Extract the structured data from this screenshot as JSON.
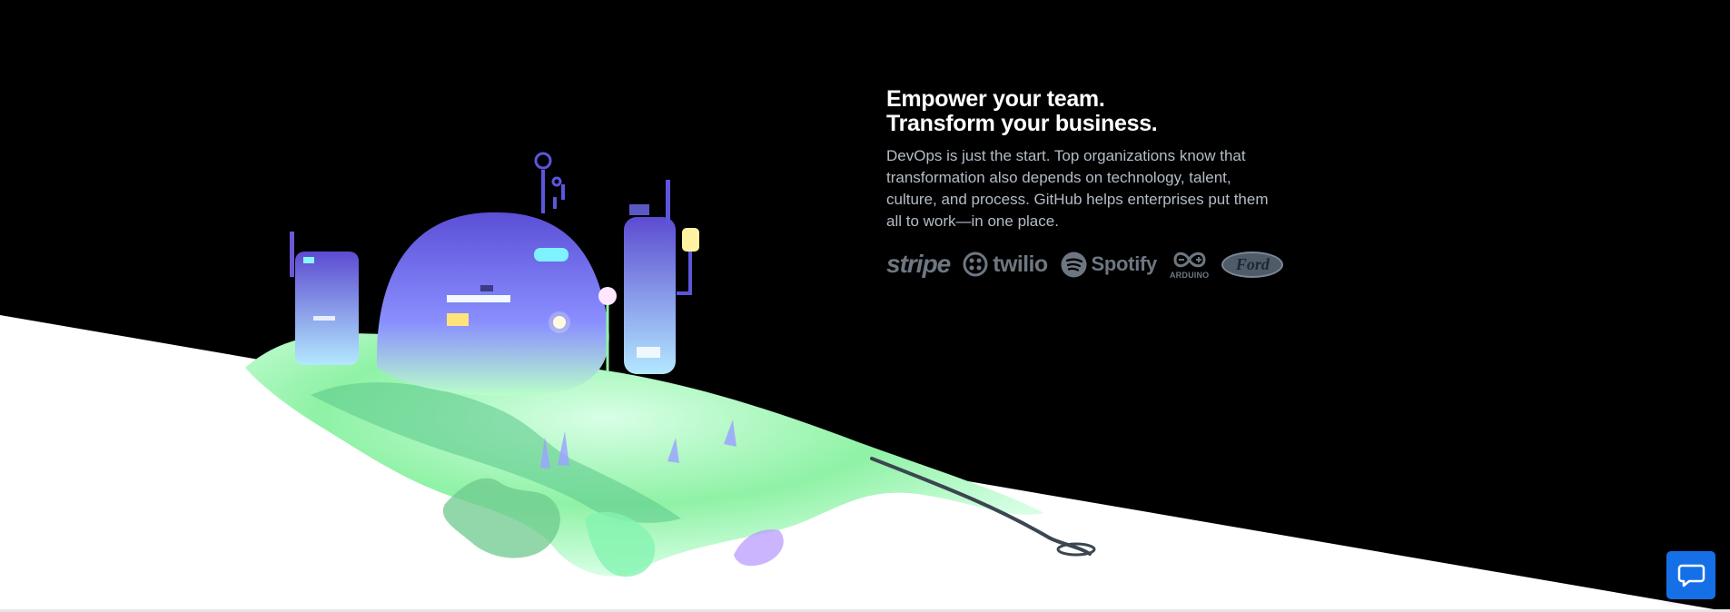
{
  "hero": {
    "headline_line_1": "Empower your team.",
    "headline_line_2": "Transform your business.",
    "body": "DevOps is just the start. Top organizations know that transformation also depends on technology, talent, culture, and process. GitHub helps enterprises put them all to work—in one place."
  },
  "customer_logos": [
    {
      "label": "stripe",
      "icon": "stripe-logo"
    },
    {
      "label": "twilio",
      "icon": "twilio-logo"
    },
    {
      "label": "Spotify",
      "icon": "spotify-logo"
    },
    {
      "label": "ARDUINO",
      "icon": "arduino-logo"
    },
    {
      "label": "Ford",
      "icon": "ford-logo"
    }
  ],
  "chat": {
    "icon": "chat-bubble-icon"
  },
  "colors": {
    "background_dark": "#000000",
    "background_light": "#ffffff",
    "headline": "#ffffff",
    "body_text": "#b4bcc6",
    "logo_gray": "#6e7781",
    "chat_blue": "#1570e8",
    "illustration_green": "#8ff2a5",
    "illustration_purple": "#6858d8"
  }
}
